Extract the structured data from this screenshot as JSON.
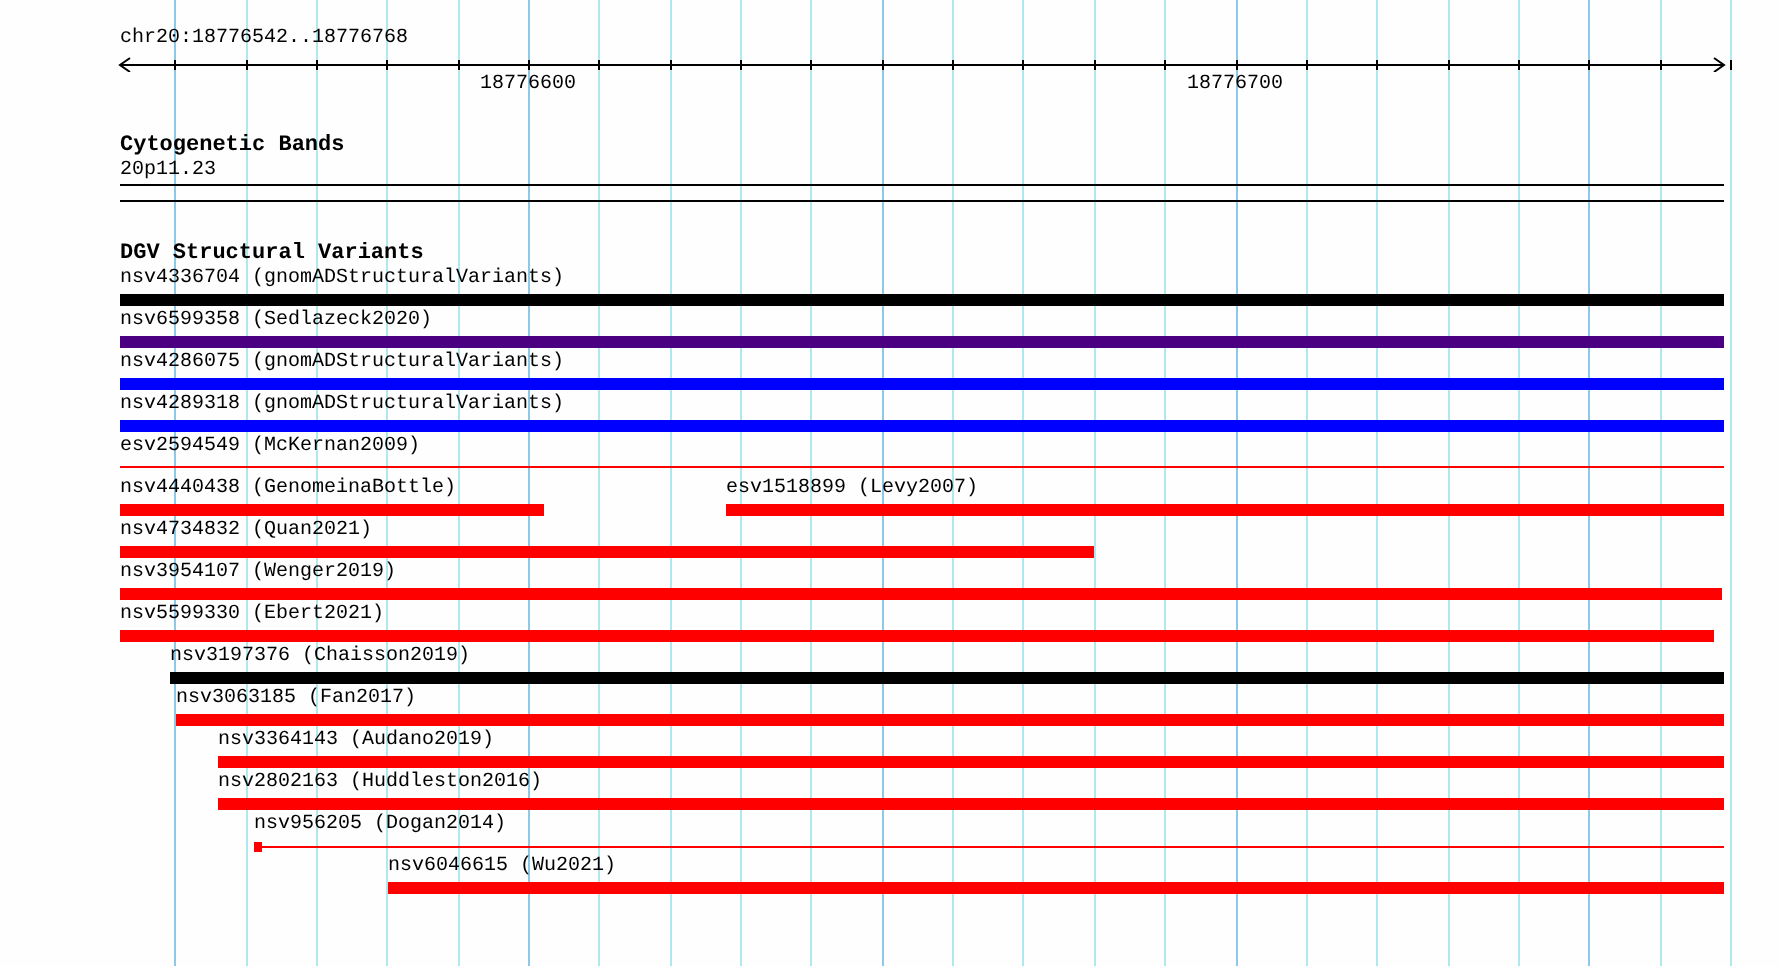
{
  "ruler": {
    "location": "chr20:18776542..18776768",
    "ticks": [
      "18776600",
      "18776700"
    ]
  },
  "tracks": [
    {
      "title": "Cytogenetic Bands",
      "features": [
        {
          "label": "20p11.23",
          "color": "#000000"
        }
      ]
    }
  ],
  "dgv": {
    "title": "DGV Structural Variants",
    "rows": [
      {
        "features": [
          {
            "label": "nsv4336704 (gnomADStructuralVariants)",
            "kind": "bar",
            "color": "#000000"
          }
        ]
      },
      {
        "features": [
          {
            "label": "nsv6599358 (Sedlazeck2020)",
            "kind": "bar",
            "color": "#4b0082"
          }
        ]
      },
      {
        "features": [
          {
            "label": "nsv4286075 (gnomADStructuralVariants)",
            "kind": "bar",
            "color": "#0000ff"
          }
        ]
      },
      {
        "features": [
          {
            "label": "nsv4289318 (gnomADStructuralVariants)",
            "kind": "bar",
            "color": "#0000ff"
          }
        ]
      },
      {
        "features": [
          {
            "label": "esv2594549 (McKernan2009)",
            "kind": "line",
            "color": "#ff0000"
          }
        ]
      },
      {
        "features": [
          {
            "label": "nsv4440438 (GenomeinaBottle)",
            "kind": "bar",
            "color": "#ff0000"
          },
          {
            "label": "esv1518899 (Levy2007)",
            "kind": "bar",
            "color": "#ff0000"
          }
        ]
      },
      {
        "features": [
          {
            "label": "nsv4734832 (Quan2021)",
            "kind": "bar",
            "color": "#ff0000"
          }
        ]
      },
      {
        "features": [
          {
            "label": "nsv3954107 (Wenger2019)",
            "kind": "bar",
            "color": "#ff0000"
          }
        ]
      },
      {
        "features": [
          {
            "label": "nsv5599330 (Ebert2021)",
            "kind": "bar",
            "color": "#ff0000"
          }
        ]
      },
      {
        "features": [
          {
            "label": "nsv3197376 (Chaisson2019)",
            "kind": "bar",
            "color": "#000000"
          }
        ]
      },
      {
        "features": [
          {
            "label": "nsv3063185 (Fan2017)",
            "kind": "bar",
            "color": "#ff0000"
          }
        ]
      },
      {
        "features": [
          {
            "label": "nsv3364143 (Audano2019)",
            "kind": "bar",
            "color": "#ff0000"
          }
        ]
      },
      {
        "features": [
          {
            "label": "nsv2802163 (Huddleston2016)",
            "kind": "bar",
            "color": "#ff0000"
          }
        ]
      },
      {
        "features": [
          {
            "label": "nsv956205 (Dogan2014)",
            "kind": "marker_line",
            "color": "#ff0000"
          }
        ]
      },
      {
        "features": [
          {
            "label": "nsv6046615 (Wu2021)",
            "kind": "bar",
            "color": "#ff0000"
          }
        ]
      }
    ]
  }
}
